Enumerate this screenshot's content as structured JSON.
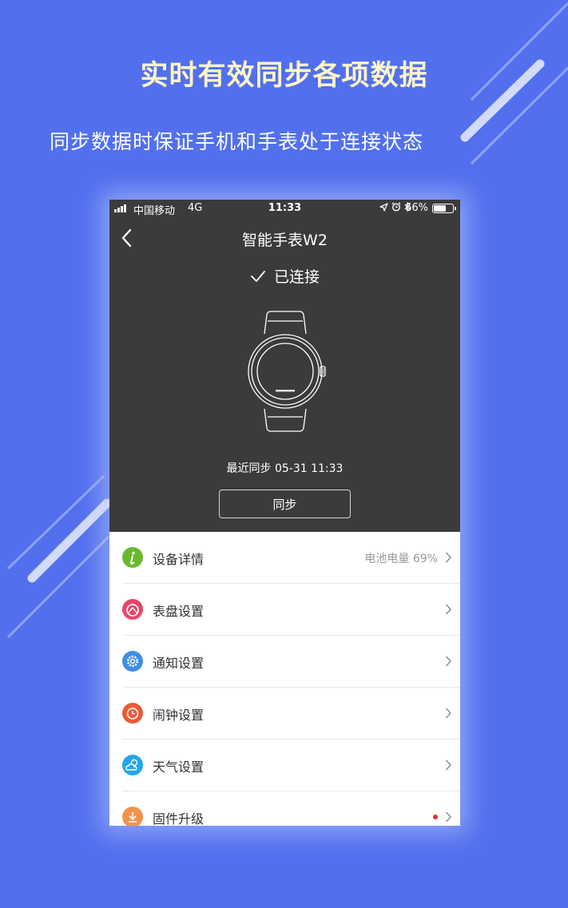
{
  "banner": {
    "headline": "实时有效同步各项数据",
    "subline": "同步数据时保证手机和手表处于连接状态"
  },
  "status_bar": {
    "carrier": "中国移动",
    "network": "4G",
    "time": "11:33",
    "battery_percent": "66%",
    "battery_level": 0.66,
    "icons": [
      "location-icon",
      "alarm-icon",
      "bluetooth-icon"
    ]
  },
  "nav": {
    "title": "智能手表W2",
    "back_icon": "chevron-left-icon"
  },
  "device": {
    "status_label": "已连接",
    "last_sync": "最近同步 05-31 11:33",
    "sync_button": "同步"
  },
  "menu": {
    "items": [
      {
        "label": "设备详情",
        "value": "电池电量 69%",
        "icon": "info-icon",
        "color": "#6ab82f"
      },
      {
        "label": "表盘设置",
        "value": "",
        "icon": "watch-face-icon",
        "color": "#e8456a"
      },
      {
        "label": "通知设置",
        "value": "",
        "icon": "gear-icon",
        "color": "#3f8de6"
      },
      {
        "label": "闹钟设置",
        "value": "",
        "icon": "alarm-clock-icon",
        "color": "#ec5a38"
      },
      {
        "label": "天气设置",
        "value": "",
        "icon": "weather-icon",
        "color": "#22a6ea"
      },
      {
        "label": "固件升级",
        "value": "",
        "icon": "firmware-icon",
        "color": "#f2924a",
        "badge": true
      }
    ]
  },
  "colors": {
    "background": "#5270ee",
    "header_dark": "#3b3b3b",
    "headline_text": "#fff6c8"
  }
}
